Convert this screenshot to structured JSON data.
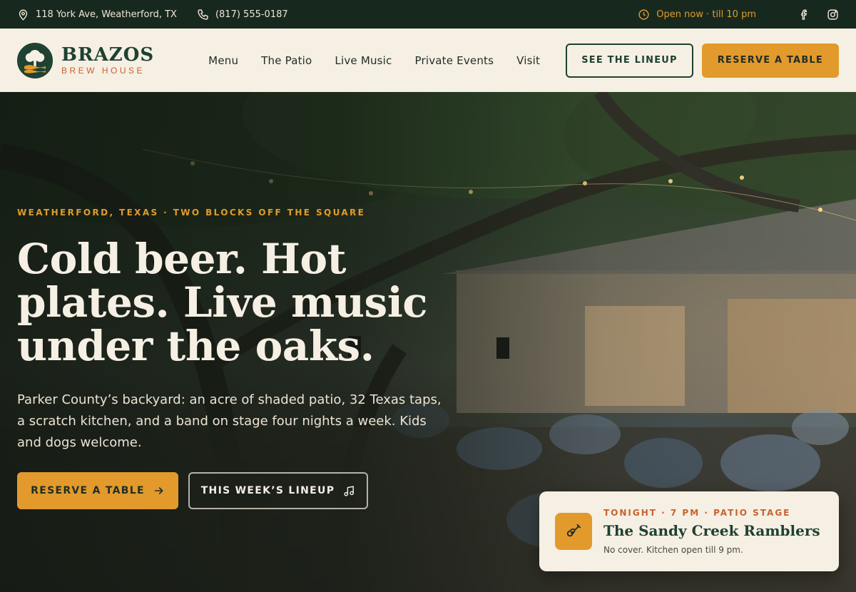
{
  "topbar": {
    "address": "118 York Ave, Weatherford, TX",
    "phone": "(817) 555-0187",
    "hours": "Open now · till 10 pm",
    "icons": [
      "location-pin-icon",
      "phone-icon",
      "clock-icon",
      "facebook-icon",
      "instagram-icon"
    ]
  },
  "brand": {
    "name": "BRAZOS",
    "subtitle": "BREW HOUSE"
  },
  "nav": {
    "items": [
      {
        "label": "Menu"
      },
      {
        "label": "The Patio"
      },
      {
        "label": "Live Music"
      },
      {
        "label": "Private Events"
      },
      {
        "label": "Visit"
      }
    ]
  },
  "header_actions": {
    "lineup_label": "SEE THE LINEUP",
    "reserve_label": "RESERVE A TABLE"
  },
  "hero": {
    "eyebrow": "WEATHERFORD, TEXAS · TWO BLOCKS OFF THE SQUARE",
    "headline": "Cold beer. Hot plates. Live music under the oaks.",
    "lede": "Parker County’s backyard: an acre of shaded patio, 32 Texas taps, a scratch kitchen, and a band on stage four nights a week. Kids and dogs welcome.",
    "primary_cta": "RESERVE A TABLE",
    "secondary_cta": "THIS WEEK’S LINEUP"
  },
  "tonight": {
    "label": "TONIGHT · 7 PM · PATIO STAGE",
    "act": "The Sandy Creek Ramblers",
    "note": "No cover. Kitchen open till 9 pm.",
    "icon": "guitar-icon"
  },
  "colors": {
    "accent": "#e29a2c",
    "brand_green": "#1e4132",
    "topbar": "#17291f",
    "cream": "#f6efe3",
    "rust": "#c9612e"
  }
}
